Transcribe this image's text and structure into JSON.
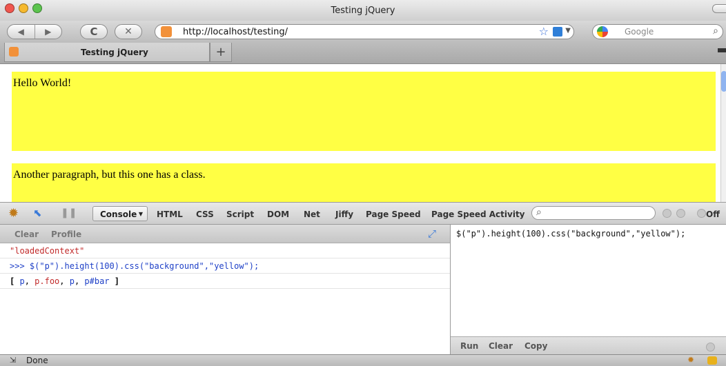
{
  "window": {
    "title": "Testing jQuery"
  },
  "nav": {
    "back_icon": "back-arrow-icon",
    "forward_icon": "forward-arrow-icon",
    "reload_icon": "reload-icon",
    "stop_icon": "stop-icon",
    "url": "http://localhost/testing/",
    "search_placeholder": "Google"
  },
  "tabs": {
    "active_label": "Testing jQuery",
    "new_tab_label": "+"
  },
  "page": {
    "paragraphs": [
      "Hello World!",
      "Another paragraph, but this one has a class."
    ],
    "paragraph_color": "#ffff44"
  },
  "firebug": {
    "tabs": [
      "Console",
      "HTML",
      "CSS",
      "Script",
      "DOM",
      "Net",
      "Jiffy",
      "Page Speed",
      "Page Speed Activity"
    ],
    "off_label": "Off",
    "subtoolbar": {
      "clear": "Clear",
      "profile": "Profile"
    },
    "log": {
      "context": "\"loadedContext\"",
      "command": ">>> $(\"p\").height(100).css(\"background\",\"yellow\");",
      "result_open": "[ ",
      "result_items": [
        "p",
        "p.foo",
        "p",
        "p#bar"
      ],
      "result_close": " ]"
    },
    "command_line": "$(\"p\").height(100).css(\"background\",\"yellow\");",
    "footer": {
      "run": "Run",
      "clear": "Clear",
      "copy": "Copy"
    }
  },
  "status": {
    "text": "Done"
  }
}
